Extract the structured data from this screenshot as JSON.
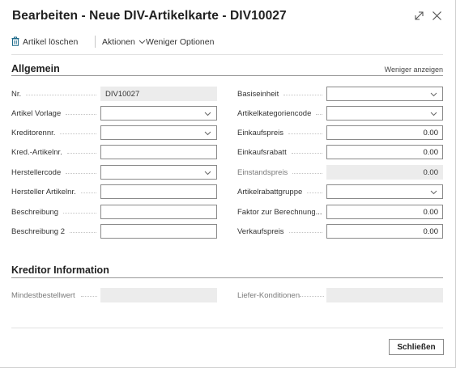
{
  "window": {
    "title": "Bearbeiten - Neue DIV-Artikelkarte - DIV10027"
  },
  "toolbar": {
    "delete_label": "Artikel löschen",
    "actions_label": "Aktionen",
    "fewer_options_label": "Weniger Optionen"
  },
  "general": {
    "title": "Allgemein",
    "show_less": "Weniger anzeigen",
    "left_fields": [
      {
        "label": "Nr.",
        "value": "DIV10027",
        "type": "readonly"
      },
      {
        "label": "Artikel Vorlage",
        "value": "",
        "type": "dropdown"
      },
      {
        "label": "Kreditorennr.",
        "value": "",
        "type": "dropdown"
      },
      {
        "label": "Kred.-Artikelnr.",
        "value": "",
        "type": "text"
      },
      {
        "label": "Herstellercode",
        "value": "",
        "type": "dropdown"
      },
      {
        "label": "Hersteller Artikelnr.",
        "value": "",
        "type": "text"
      },
      {
        "label": "Beschreibung",
        "value": "",
        "type": "text"
      },
      {
        "label": "Beschreibung 2",
        "value": "",
        "type": "text"
      }
    ],
    "right_fields": [
      {
        "label": "Basiseinheit",
        "value": "",
        "type": "dropdown"
      },
      {
        "label": "Artikelkategoriencode",
        "value": "",
        "type": "dropdown"
      },
      {
        "label": "Einkaufspreis",
        "value": "0.00",
        "type": "number"
      },
      {
        "label": "Einkaufsrabatt",
        "value": "0.00",
        "type": "number"
      },
      {
        "label": "Einstandspreis",
        "value": "0.00",
        "type": "readonly-number"
      },
      {
        "label": "Artikelrabattgruppe",
        "value": "",
        "type": "dropdown"
      },
      {
        "label": "Faktor zur Berechnung...",
        "value": "0.00",
        "type": "number"
      },
      {
        "label": "Verkaufspreis",
        "value": "0.00",
        "type": "number"
      }
    ]
  },
  "vendor": {
    "title": "Kreditor Information",
    "left_field": {
      "label": "Mindestbestellwert",
      "value": ""
    },
    "right_field": {
      "label": "Liefer-Konditionen",
      "value": ""
    }
  },
  "footer": {
    "close_label": "Schließen"
  },
  "icons": {
    "delete": "trash-icon",
    "actions_chevron": "chevron-down-icon",
    "expand": "expand-icon",
    "close": "close-icon"
  }
}
